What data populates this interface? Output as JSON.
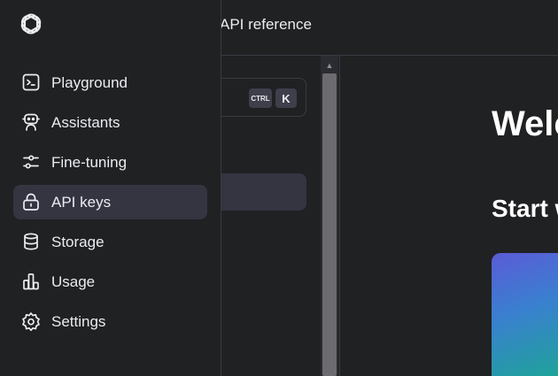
{
  "topbar": {
    "link": "API reference"
  },
  "search": {
    "shortcut_mod": "CTRL",
    "shortcut_key": "K"
  },
  "main": {
    "heading": "Welc",
    "subheading": "Start w"
  },
  "nav": {
    "items": [
      {
        "label": "Playground",
        "icon": "terminal-icon"
      },
      {
        "label": "Assistants",
        "icon": "robot-icon"
      },
      {
        "label": "Fine-tuning",
        "icon": "sliders-icon"
      },
      {
        "label": "API keys",
        "icon": "lock-icon",
        "selected": true
      },
      {
        "label": "Storage",
        "icon": "database-icon"
      },
      {
        "label": "Usage",
        "icon": "bar-chart-icon"
      },
      {
        "label": "Settings",
        "icon": "gear-icon"
      }
    ]
  },
  "colors": {
    "background": "#202123",
    "selected": "#343541",
    "text": "#ececf1",
    "border": "#3a3b42",
    "card_gradient": [
      "#5b5bd6",
      "#3a7fd0",
      "#1fa39a"
    ]
  }
}
